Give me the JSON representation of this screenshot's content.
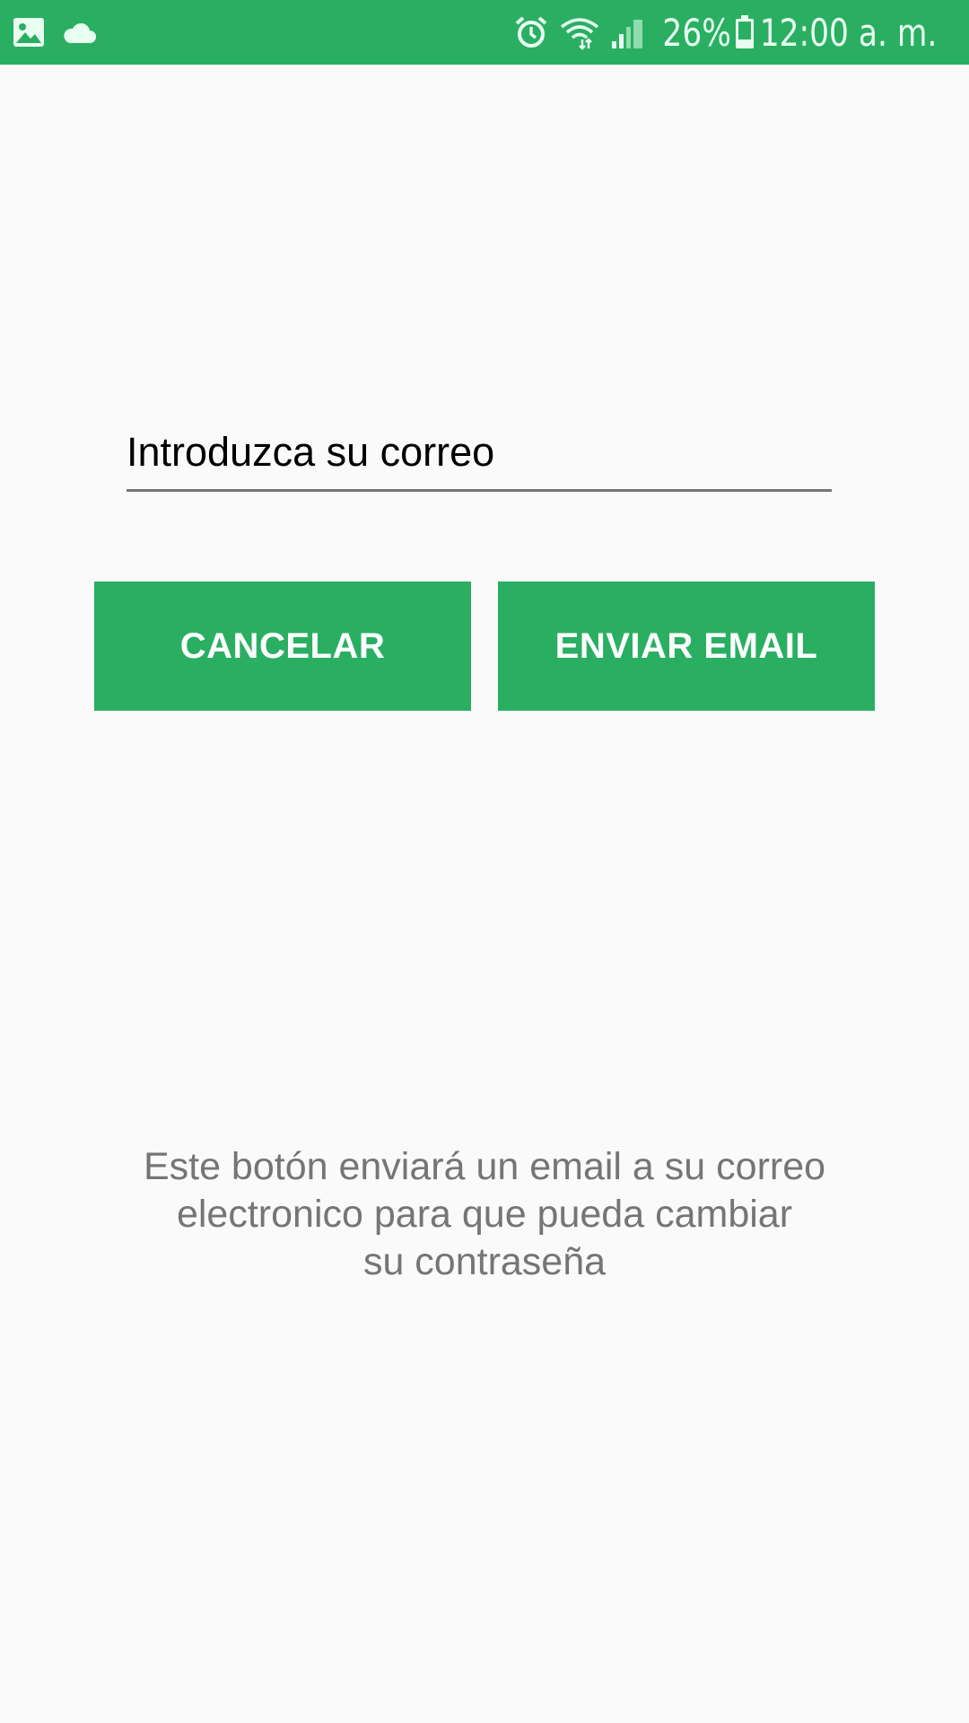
{
  "status_bar": {
    "background": "#2aaf62",
    "left_icons": [
      "image-icon",
      "cloud-icon"
    ],
    "right_icons": [
      "alarm-icon",
      "wifi-icon",
      "signal-icon",
      "battery-icon"
    ],
    "battery": "26%",
    "time": "12:00 a. m."
  },
  "form": {
    "email_placeholder": "Introduzca su correo",
    "email_value": "",
    "cancel_label": "CANCELAR",
    "send_label": "ENVIAR EMAIL",
    "button_color": "#2aaf62"
  },
  "info": {
    "lines": [
      "Este botón enviará un email a su correo",
      "electronico para que pueda cambiar",
      "su contraseña"
    ]
  }
}
